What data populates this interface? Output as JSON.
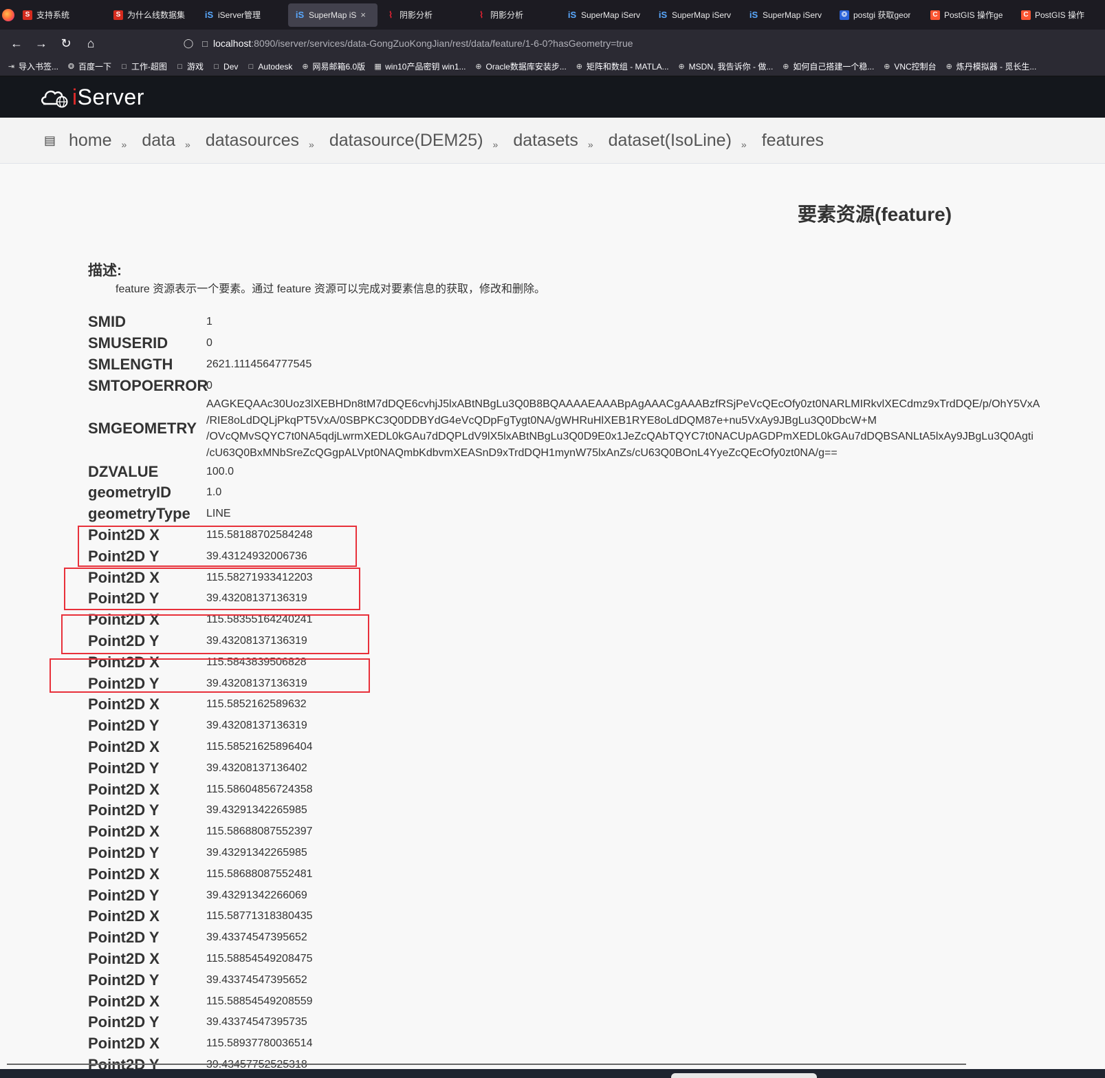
{
  "browser": {
    "tabs": [
      {
        "icon": "s-icon",
        "label": "支持系统"
      },
      {
        "icon": "s-icon",
        "label": "为什么线数据集"
      },
      {
        "icon": "is-icon",
        "label": "iServer管理"
      },
      {
        "icon": "is-icon",
        "label": "SuperMap iS",
        "active": true
      },
      {
        "icon": "wave-icon",
        "label": "阴影分析"
      },
      {
        "icon": "wave-icon",
        "label": "阴影分析"
      },
      {
        "icon": "is-icon",
        "label": "SuperMap iServ"
      },
      {
        "icon": "is-icon",
        "label": "SuperMap iServ"
      },
      {
        "icon": "is-icon",
        "label": "SuperMap iServ"
      },
      {
        "icon": "baidu-icon",
        "label": "postgi 获取geor"
      },
      {
        "icon": "c-icon",
        "label": "PostGIS 操作ge"
      },
      {
        "icon": "c-icon",
        "label": "PostGIS 操作"
      }
    ],
    "url_host": "localhost",
    "url_path": ":8090/iserver/services/data-GongZuoKongJian/rest/data/feature/1-6-0?hasGeometry=true",
    "bookmarks": [
      {
        "icon": "import-icon",
        "label": "导入书签..."
      },
      {
        "icon": "baidu-icon",
        "label": "百度一下"
      },
      {
        "icon": "folder-icon",
        "label": "工作-超图"
      },
      {
        "icon": "folder-icon",
        "label": "游戏"
      },
      {
        "icon": "folder-icon",
        "label": "Dev"
      },
      {
        "icon": "folder-icon",
        "label": "Autodesk"
      },
      {
        "icon": "globe-icon",
        "label": "网易邮箱6.0版"
      },
      {
        "icon": "grid-icon",
        "label": "win10产品密钥 win1..."
      },
      {
        "icon": "globe-icon",
        "label": "Oracle数据库安装步..."
      },
      {
        "icon": "globe-icon",
        "label": "矩阵和数组 - MATLA..."
      },
      {
        "icon": "globe-icon",
        "label": "MSDN, 我告诉你 - 做..."
      },
      {
        "icon": "globe-icon",
        "label": "如何自己搭建一个稳..."
      },
      {
        "icon": "globe-icon",
        "label": "VNC控制台"
      },
      {
        "icon": "globe-icon",
        "label": "炼丹模拟器 - 觅长生..."
      }
    ]
  },
  "app": {
    "logo_i": "i",
    "logo_rest": "Server"
  },
  "breadcrumb": [
    "home",
    "data",
    "datasources",
    "datasource(DEM25)",
    "datasets",
    "dataset(IsoLine)",
    "features"
  ],
  "breadcrumb_sep": "»",
  "page": {
    "title": "要素资源(feature)",
    "desc_label": "描述:",
    "desc_text": "feature 资源表示一个要素。通过 feature 资源可以完成对要素信息的获取，修改和删除。"
  },
  "fields": [
    {
      "key": "SMID",
      "value": "1"
    },
    {
      "key": "SMUSERID",
      "value": "0"
    },
    {
      "key": "SMLENGTH",
      "value": "2621.1114564777545"
    },
    {
      "key": "SMTOPOERROR",
      "value": "0"
    }
  ],
  "geometry": {
    "key": "SMGEOMETRY",
    "lines": [
      "AAGKEQAAc30Uoz3lXEBHDn8tM7dDQE6cvhjJ5lxABtNBgLu3Q0B8BQAAAAEAAABpAgAAACgAAABzfRSjPeVcQEcOfy0zt0NARLMIRkvlXECdmz9xTrdDQE/p/OhY5VxA",
      "/RIE8oLdDQLjPkqPT5VxA/0SBPKC3Q0DDBYdG4eVcQDpFgTygt0NA/gWHRuHlXEB1RYE8oLdDQM87e+nu5VxAy9JBgLu3Q0DbcW+M",
      "/OVcQMvSQYC7t0NA5qdjLwrmXEDL0kGAu7dDQPLdV9lX5lxABtNBgLu3Q0D9E0x1JeZcQAbTQYC7t0NACUpAGDPmXEDL0kGAu7dDQBSANLtA5lxAy9JBgLu3Q0Agti",
      "/cU63Q0BxMNbSreZcQGgpALVpt0NAQmbKdbvmXEASnD9xTrdDQH1mynW75lxAnZs/cU63Q0BOnL4YyeZcQEcOfy0zt0NA/g=="
    ]
  },
  "fields2": [
    {
      "key": "DZVALUE",
      "value": "100.0"
    },
    {
      "key": "geometryID",
      "value": "1.0"
    },
    {
      "key": "geometryType",
      "value": "LINE"
    }
  ],
  "points": [
    {
      "key": "Point2D X",
      "value": "115.58188702584248"
    },
    {
      "key": "Point2D Y",
      "value": "39.43124932006736"
    },
    {
      "key": "Point2D X",
      "value": "115.58271933412203"
    },
    {
      "key": "Point2D Y",
      "value": "39.43208137136319"
    },
    {
      "key": "Point2D X",
      "value": "115.58355164240241"
    },
    {
      "key": "Point2D Y",
      "value": "39.43208137136319"
    },
    {
      "key": "Point2D X",
      "value": "115.5843839506828"
    },
    {
      "key": "Point2D Y",
      "value": "39.43208137136319"
    },
    {
      "key": "Point2D X",
      "value": "115.5852162589632"
    },
    {
      "key": "Point2D Y",
      "value": "39.43208137136319"
    },
    {
      "key": "Point2D X",
      "value": "115.58521625896404"
    },
    {
      "key": "Point2D Y",
      "value": "39.43208137136402"
    },
    {
      "key": "Point2D X",
      "value": "115.58604856724358"
    },
    {
      "key": "Point2D Y",
      "value": "39.43291342265985"
    },
    {
      "key": "Point2D X",
      "value": "115.58688087552397"
    },
    {
      "key": "Point2D Y",
      "value": "39.43291342265985"
    },
    {
      "key": "Point2D X",
      "value": "115.58688087552481"
    },
    {
      "key": "Point2D Y",
      "value": "39.43291342266069"
    },
    {
      "key": "Point2D X",
      "value": "115.58771318380435"
    },
    {
      "key": "Point2D Y",
      "value": "39.43374547395652"
    },
    {
      "key": "Point2D X",
      "value": "115.58854549208475"
    },
    {
      "key": "Point2D Y",
      "value": "39.43374547395652"
    },
    {
      "key": "Point2D X",
      "value": "115.58854549208559"
    },
    {
      "key": "Point2D Y",
      "value": "39.43374547395735"
    },
    {
      "key": "Point2D X",
      "value": "115.58937780036514"
    },
    {
      "key": "Point2D Y",
      "value": "39.43457752525318"
    }
  ],
  "colors": {
    "highlight_box": "#e8303a",
    "header_bg": "#14171c",
    "logo_accent": "#e02b2b"
  }
}
